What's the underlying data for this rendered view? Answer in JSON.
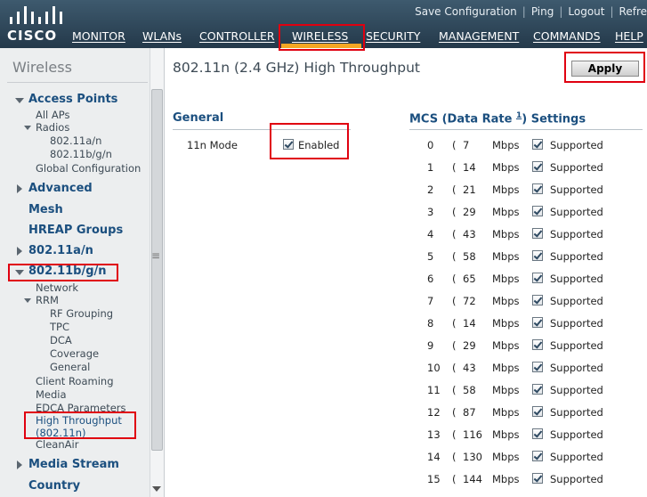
{
  "header": {
    "logo_text": "CISCO",
    "top_links": [
      "Save Configuration",
      "Ping",
      "Logout",
      "Refre"
    ],
    "nav": [
      "MONITOR",
      "WLANs",
      "CONTROLLER",
      "WIRELESS",
      "SECURITY",
      "MANAGEMENT",
      "COMMANDS",
      "HELP"
    ],
    "active_nav": "WIRELESS",
    "accent_color": "#f5a623"
  },
  "sidebar": {
    "title": "Wireless",
    "items": [
      {
        "label": "Access Points",
        "kind": "header",
        "icon": "triangle-down"
      },
      {
        "label": "All APs",
        "kind": "link"
      },
      {
        "label": "Radios",
        "kind": "link",
        "icon": "triangle-down"
      },
      {
        "label": "802.11a/n",
        "kind": "link"
      },
      {
        "label": "802.11b/g/n",
        "kind": "link"
      },
      {
        "label": "Global Configuration",
        "kind": "link"
      },
      {
        "label": "Advanced",
        "kind": "header",
        "icon": "triangle-right"
      },
      {
        "label": "Mesh",
        "kind": "header"
      },
      {
        "label": "HREAP Groups",
        "kind": "header"
      },
      {
        "label": "802.11a/n",
        "kind": "header",
        "icon": "triangle-right"
      },
      {
        "label": "802.11b/g/n",
        "kind": "header",
        "icon": "triangle-down"
      },
      {
        "label": "Network",
        "kind": "link"
      },
      {
        "label": "RRM",
        "kind": "link",
        "icon": "triangle-down"
      },
      {
        "label": "RF Grouping",
        "kind": "link"
      },
      {
        "label": "TPC",
        "kind": "link"
      },
      {
        "label": "DCA",
        "kind": "link"
      },
      {
        "label": "Coverage",
        "kind": "link"
      },
      {
        "label": "General",
        "kind": "link"
      },
      {
        "label": "Client Roaming",
        "kind": "link"
      },
      {
        "label": "Media",
        "kind": "link"
      },
      {
        "label": "EDCA Parameters",
        "kind": "link"
      },
      {
        "label": "High Throughput",
        "kind": "link",
        "selected": true
      },
      {
        "label": "(802.11n)",
        "kind": "link",
        "selected": true
      },
      {
        "label": "CleanAir",
        "kind": "link"
      },
      {
        "label": "Media Stream",
        "kind": "header",
        "icon": "triangle-right"
      },
      {
        "label": "Country",
        "kind": "header"
      }
    ]
  },
  "main": {
    "title": "802.11n (2.4 GHz) High Throughput",
    "apply_label": "Apply",
    "general": {
      "heading": "General",
      "mode_label": "11n Mode",
      "mode_checked": true,
      "mode_value": "Enabled"
    },
    "mcs": {
      "heading_prefix": "MCS (Data Rate",
      "footnote": "1",
      "heading_suffix": ") Settings",
      "unit": "Mbps",
      "supported_label": "Supported",
      "rows": [
        {
          "index": "0",
          "rate": "7",
          "checked": true
        },
        {
          "index": "1",
          "rate": "14",
          "checked": true
        },
        {
          "index": "2",
          "rate": "21",
          "checked": true
        },
        {
          "index": "3",
          "rate": "29",
          "checked": true
        },
        {
          "index": "4",
          "rate": "43",
          "checked": true
        },
        {
          "index": "5",
          "rate": "58",
          "checked": true
        },
        {
          "index": "6",
          "rate": "65",
          "checked": true
        },
        {
          "index": "7",
          "rate": "72",
          "checked": true
        },
        {
          "index": "8",
          "rate": "14",
          "checked": true
        },
        {
          "index": "9",
          "rate": "29",
          "checked": true
        },
        {
          "index": "10",
          "rate": "43",
          "checked": true
        },
        {
          "index": "11",
          "rate": "58",
          "checked": true
        },
        {
          "index": "12",
          "rate": "87",
          "checked": true
        },
        {
          "index": "13",
          "rate": "116",
          "checked": true
        },
        {
          "index": "14",
          "rate": "130",
          "checked": true
        },
        {
          "index": "15",
          "rate": "144",
          "checked": true
        }
      ]
    }
  }
}
